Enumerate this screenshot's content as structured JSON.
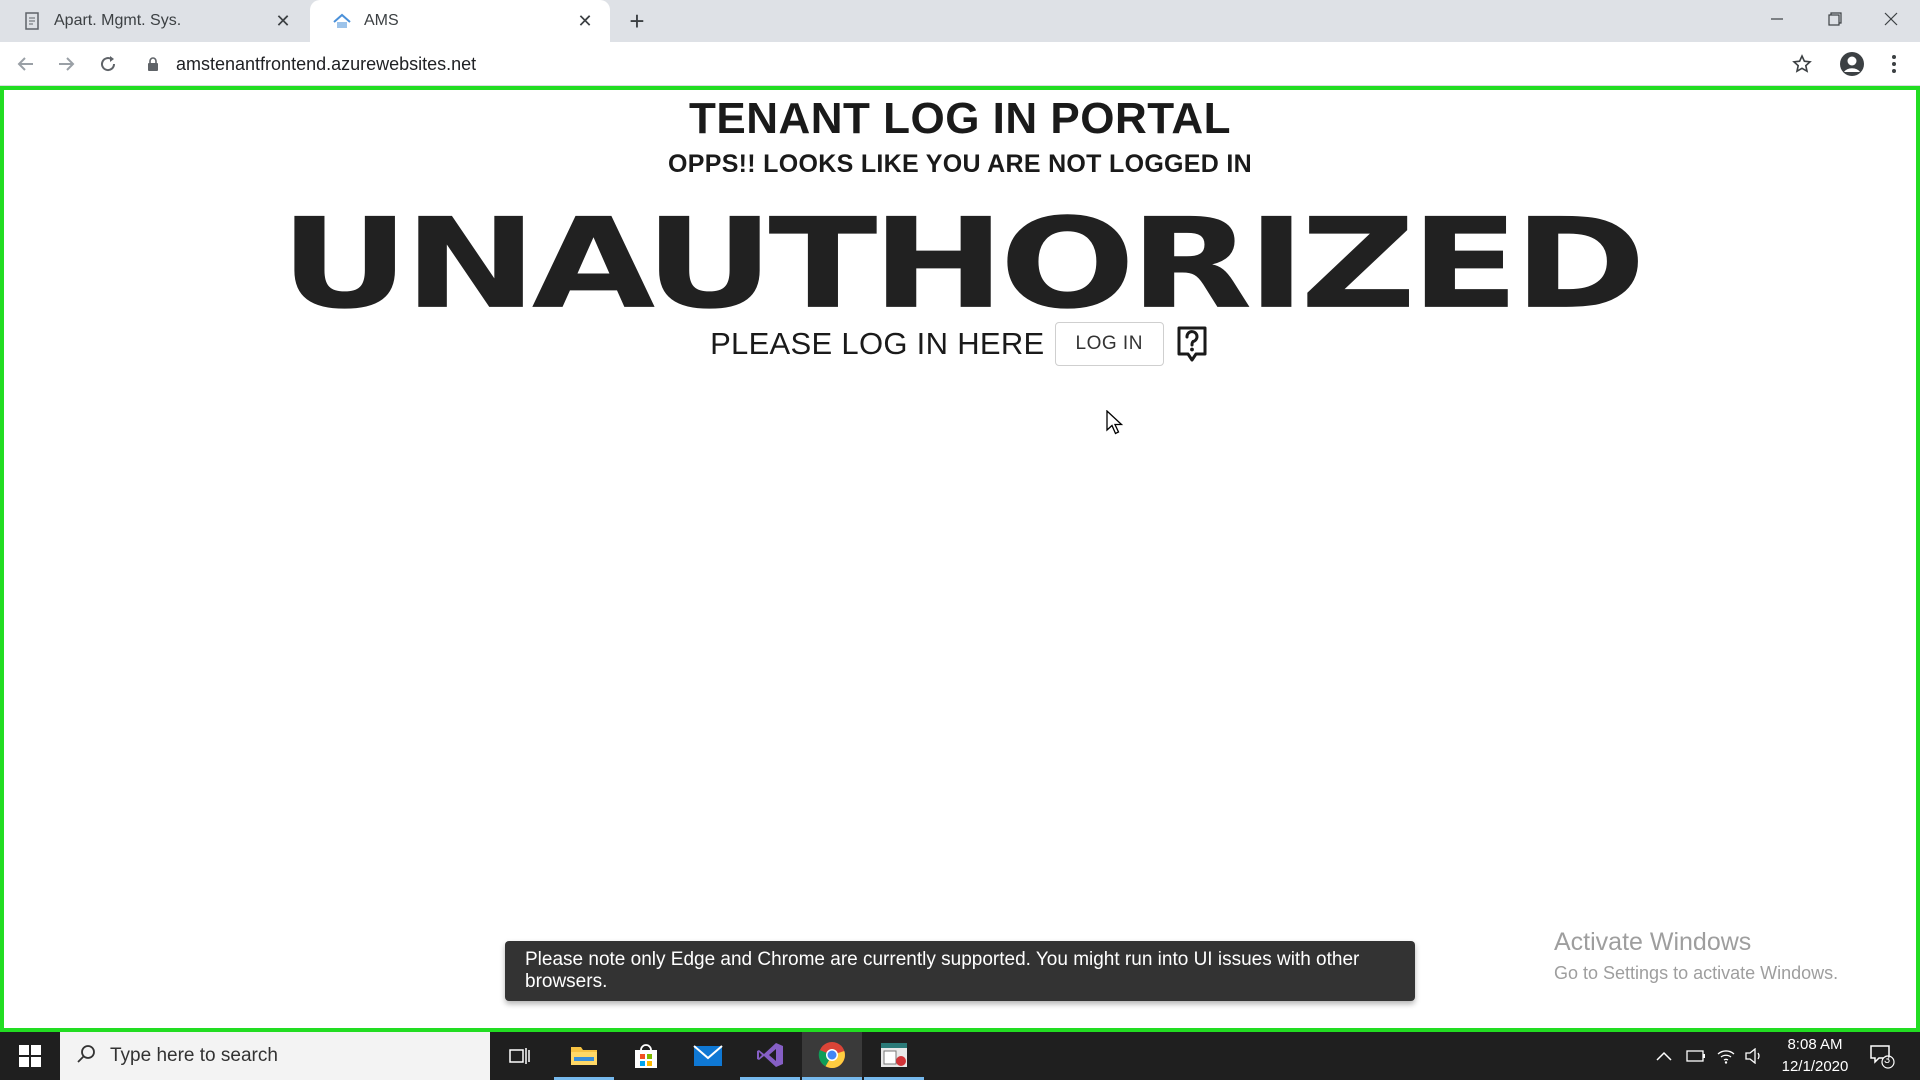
{
  "browser": {
    "tabs": [
      {
        "label": "Apart. Mgmt. Sys.",
        "active": false
      },
      {
        "label": "AMS",
        "active": true
      }
    ],
    "new_tab": "+",
    "url": "amstenantfrontend.azurewebsites.net"
  },
  "page": {
    "title": "TENANT LOG IN PORTAL",
    "subtitle": "OPPS!! LOOKS LIKE YOU ARE NOT LOGGED IN",
    "hero": "UNAUTHORIZED",
    "login_prompt": "PLEASE LOG IN HERE",
    "login_button": "LOG IN",
    "help_icon": "question-bubble-icon",
    "toast": "Please note only Edge and Chrome are currently supported. You might run into UI issues with other browsers.",
    "frame_color": "#22dd22"
  },
  "watermark": {
    "line1": "Activate Windows",
    "line2": "Go to Settings to activate Windows."
  },
  "taskbar": {
    "search_placeholder": "Type here to search",
    "apps": [
      "task-view-icon",
      "file-explorer-icon",
      "store-icon",
      "mail-icon",
      "visual-studio-icon",
      "chrome-icon",
      "app-icon"
    ],
    "time": "8:08 AM",
    "date": "12/1/2020",
    "notification_count": "3"
  }
}
